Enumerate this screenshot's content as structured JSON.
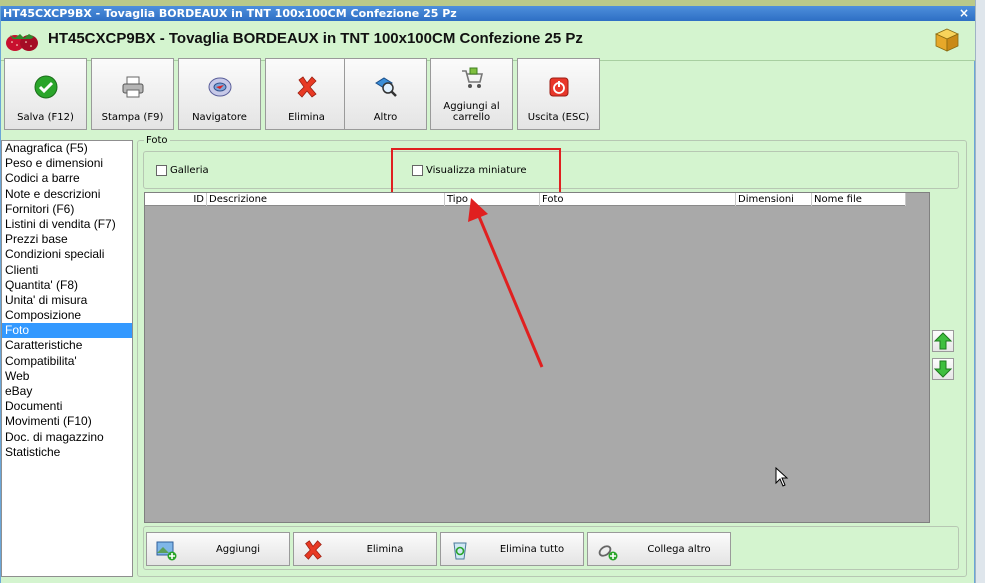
{
  "window": {
    "title": "HT45CXCP9BX - Tovaglia BORDEAUX in TNT 100x100CM Confezione 25 Pz",
    "close": "×"
  },
  "header": {
    "title": "HT45CXCP9BX - Tovaglia BORDEAUX in TNT 100x100CM Confezione 25 Pz"
  },
  "toolbar": {
    "buttons": [
      {
        "label": "Salva (F12)",
        "icon": "check-icon"
      },
      {
        "label": "Stampa (F9)",
        "icon": "printer-icon"
      },
      {
        "label": "Navigatore",
        "icon": "compass-icon"
      },
      {
        "label": "Elimina",
        "icon": "delete-x-icon"
      },
      {
        "label": "Altro",
        "icon": "search-icon"
      },
      {
        "label": "Aggiungi al carrello",
        "icon": "cart-icon"
      },
      {
        "label": "Uscita (ESC)",
        "icon": "power-icon"
      }
    ]
  },
  "sidebar": {
    "items": [
      "Anagrafica (F5)",
      "Peso e dimensioni",
      "Codici a barre",
      "Note e descrizioni",
      "Fornitori (F6)",
      "Listini di vendita (F7)",
      "Prezzi base",
      "Condizioni speciali",
      "Clienti",
      "Quantita' (F8)",
      "Unita' di misura",
      "Composizione",
      "Foto",
      "Caratteristiche",
      "Compatibilita'",
      "Web",
      "eBay",
      "Documenti",
      "Movimenti (F10)",
      "Doc. di magazzino",
      "Statistiche"
    ],
    "active": "Foto"
  },
  "foto": {
    "group_label": "Foto",
    "galleria_label": "Galleria",
    "miniature_label": "Visualizza miniature",
    "columns": [
      "ID",
      "Descrizione",
      "Tipo",
      "Foto",
      "Dimensioni",
      "Nome file"
    ]
  },
  "bottom": {
    "buttons": [
      {
        "label": "Aggiungi",
        "icon": "add-image-icon"
      },
      {
        "label": "Elimina",
        "icon": "delete-x-icon"
      },
      {
        "label": "Elimina tutto",
        "icon": "recycle-bin-icon"
      },
      {
        "label": "Collega altro",
        "icon": "link-user-icon"
      }
    ]
  },
  "colors": {
    "window_bg": "#d4f4cf",
    "titlebar": "#2e6fc4",
    "selection": "#3399ff",
    "annotation": "#e02020",
    "grid_bg": "#a9a9a9"
  }
}
